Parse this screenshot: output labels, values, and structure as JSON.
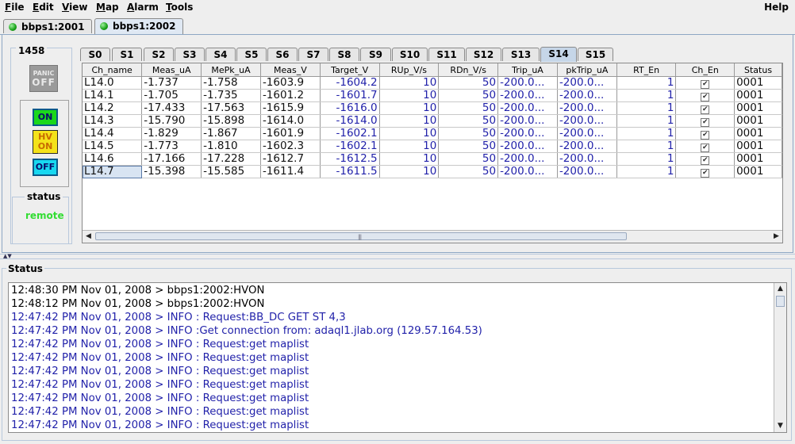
{
  "menus": [
    {
      "pre": "",
      "u": "F",
      "post": "ile"
    },
    {
      "pre": "",
      "u": "E",
      "post": "dit"
    },
    {
      "pre": "",
      "u": "V",
      "post": "iew"
    },
    {
      "pre": "",
      "u": "M",
      "post": "ap"
    },
    {
      "pre": "",
      "u": "A",
      "post": "larm"
    },
    {
      "pre": "",
      "u": "T",
      "post": "ools"
    }
  ],
  "help": "Help",
  "connection_tabs": [
    {
      "label": "bbps1:2001",
      "active": false
    },
    {
      "label": "bbps1:2002",
      "active": true
    }
  ],
  "crate_id": "1458",
  "panic": {
    "top": "PANIC",
    "bottom": "OFF"
  },
  "hv_buttons": {
    "on": "ON",
    "hvon_top": "HV",
    "hvon_bottom": "ON",
    "off": "OFF"
  },
  "status_group": {
    "title": "status",
    "value": "remote"
  },
  "slot_tabs": [
    "S0",
    "S1",
    "S2",
    "S3",
    "S4",
    "S5",
    "S6",
    "S7",
    "S8",
    "S9",
    "S10",
    "S11",
    "S12",
    "S13",
    "S14",
    "S15"
  ],
  "active_slot": "S14",
  "table": {
    "headers": [
      "Ch_name",
      "Meas_uA",
      "MePk_uA",
      "Meas_V",
      "Target_V",
      "RUp_V/s",
      "RDn_V/s",
      "Trip_uA",
      "pkTrip_uA",
      "RT_En",
      "Ch_En",
      "Status"
    ],
    "rows": [
      [
        "L14.0",
        "-1.737",
        "-1.758",
        "-1603.9",
        "-1604.2",
        "10",
        "50",
        "-200.0...",
        "-200.0...",
        "1",
        "✔",
        "0001"
      ],
      [
        "L14.1",
        "-1.705",
        "-1.735",
        "-1601.2",
        "-1601.7",
        "10",
        "50",
        "-200.0...",
        "-200.0...",
        "1",
        "✔",
        "0001"
      ],
      [
        "L14.2",
        "-17.433",
        "-17.563",
        "-1615.9",
        "-1616.0",
        "10",
        "50",
        "-200.0...",
        "-200.0...",
        "1",
        "✔",
        "0001"
      ],
      [
        "L14.3",
        "-15.790",
        "-15.898",
        "-1614.0",
        "-1614.0",
        "10",
        "50",
        "-200.0...",
        "-200.0...",
        "1",
        "✔",
        "0001"
      ],
      [
        "L14.4",
        "-1.829",
        "-1.867",
        "-1601.9",
        "-1602.1",
        "10",
        "50",
        "-200.0...",
        "-200.0...",
        "1",
        "✔",
        "0001"
      ],
      [
        "L14.5",
        "-1.773",
        "-1.810",
        "-1602.3",
        "-1602.1",
        "10",
        "50",
        "-200.0...",
        "-200.0...",
        "1",
        "✔",
        "0001"
      ],
      [
        "L14.6",
        "-17.166",
        "-17.228",
        "-1612.7",
        "-1612.5",
        "10",
        "50",
        "-200.0...",
        "-200.0...",
        "1",
        "✔",
        "0001"
      ],
      [
        "L14.7",
        "-15.398",
        "-15.585",
        "-1611.4",
        "-1611.5",
        "10",
        "50",
        "-200.0...",
        "-200.0...",
        "1",
        "✔",
        "0001"
      ]
    ]
  },
  "status_panel_title": "Status",
  "log": [
    {
      "text": "12:48:30 PM Nov 01, 2008 > bbps1:2002:HVON",
      "color": "black"
    },
    {
      "text": "12:48:12 PM Nov 01, 2008 > bbps1:2002:HVON",
      "color": "black"
    },
    {
      "text": "12:47:42 PM Nov 01, 2008 > INFO : Request:BB_DC GET ST 4,3",
      "color": "blue"
    },
    {
      "text": "12:47:42 PM Nov 01, 2008 > INFO :Get connection from: adaql1.jlab.org (129.57.164.53)",
      "color": "blue"
    },
    {
      "text": "12:47:42 PM Nov 01, 2008 > INFO : Request:get maplist",
      "color": "blue"
    },
    {
      "text": "12:47:42 PM Nov 01, 2008 > INFO : Request:get maplist",
      "color": "blue"
    },
    {
      "text": "12:47:42 PM Nov 01, 2008 > INFO : Request:get maplist",
      "color": "blue"
    },
    {
      "text": "12:47:42 PM Nov 01, 2008 > INFO : Request:get maplist",
      "color": "blue"
    },
    {
      "text": "12:47:42 PM Nov 01, 2008 > INFO : Request:get maplist",
      "color": "blue"
    },
    {
      "text": "12:47:42 PM Nov 01, 2008 > INFO : Request:get maplist",
      "color": "blue"
    },
    {
      "text": "12:47:42 PM Nov 01, 2008 > INFO : Request:get maplist",
      "color": "blue"
    }
  ]
}
